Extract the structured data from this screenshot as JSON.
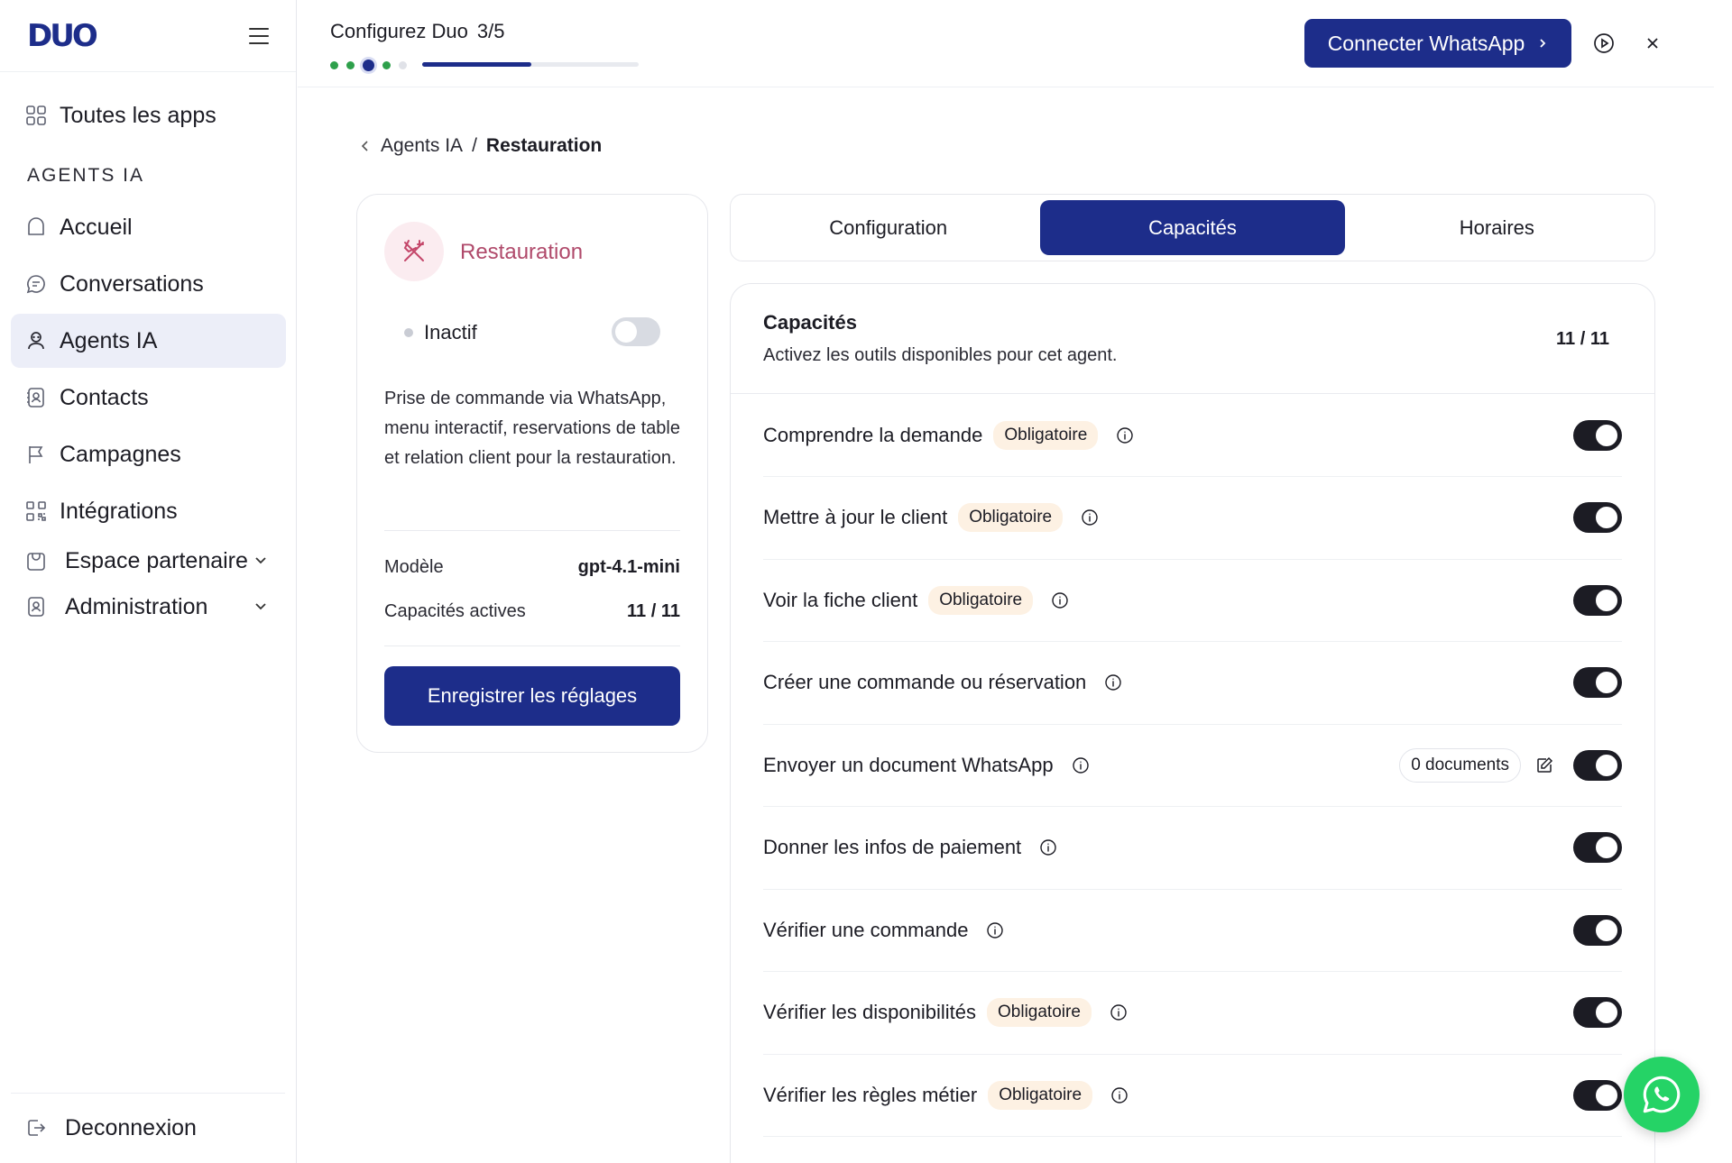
{
  "brand": {
    "logo_text": "DUO",
    "accent": "#1d2d8a",
    "success": "#2ea04b",
    "whatsapp_green": "#25d366"
  },
  "sidebar": {
    "all_apps": "Toutes les apps",
    "section_label": "AGENTS IA",
    "items": [
      {
        "label": "Accueil",
        "icon": "home-icon"
      },
      {
        "label": "Conversations",
        "icon": "chat-icon"
      },
      {
        "label": "Agents IA",
        "icon": "robot-icon",
        "active": true
      },
      {
        "label": "Contacts",
        "icon": "contacts-icon"
      },
      {
        "label": "Campagnes",
        "icon": "flag-icon"
      },
      {
        "label": "Intégrations",
        "icon": "grid-icon"
      }
    ],
    "partner": "Espace partenaire",
    "admin": "Administration",
    "logout": "Deconnexion"
  },
  "topbar": {
    "title": "Configurez Duo",
    "step": "3/5",
    "progress": 0.6,
    "connect_label": "Connecter WhatsApp"
  },
  "breadcrumb": {
    "parent": "Agents IA",
    "separator": "/",
    "current": "Restauration"
  },
  "agent": {
    "name": "Restauration",
    "status": "Inactif",
    "active": false,
    "description": "Prise de commande via WhatsApp, menu interactif, reservations de table et relation client pour la restauration.",
    "model_label": "Modèle",
    "model_value": "gpt-4.1-mini",
    "caps_label": "Capacités actives",
    "caps_value": "11 / 11",
    "save_label": "Enregistrer les réglages"
  },
  "tabs": [
    {
      "label": "Configuration"
    },
    {
      "label": "Capacités",
      "active": true
    },
    {
      "label": "Horaires"
    }
  ],
  "capabilities": {
    "title": "Capacités",
    "subtitle": "Activez les outils disponibles pour cet agent.",
    "count": "11 / 11",
    "items": [
      {
        "label": "Comprendre la demande",
        "badge": "Obligatoire",
        "enabled": true
      },
      {
        "label": "Mettre à jour le client",
        "badge": "Obligatoire",
        "enabled": true
      },
      {
        "label": "Voir la fiche client",
        "badge": "Obligatoire",
        "enabled": true
      },
      {
        "label": "Créer une commande ou réservation",
        "badge": "",
        "enabled": true
      },
      {
        "label": "Envoyer un document WhatsApp",
        "badge": "",
        "docs": "0 documents",
        "enabled": true
      },
      {
        "label": "Donner les infos de paiement",
        "badge": "",
        "enabled": true
      },
      {
        "label": "Vérifier une commande",
        "badge": "",
        "enabled": true
      },
      {
        "label": "Vérifier les disponibilités",
        "badge": "Obligatoire",
        "enabled": true
      },
      {
        "label": "Vérifier les règles métier",
        "badge": "Obligatoire",
        "enabled": true
      }
    ]
  }
}
